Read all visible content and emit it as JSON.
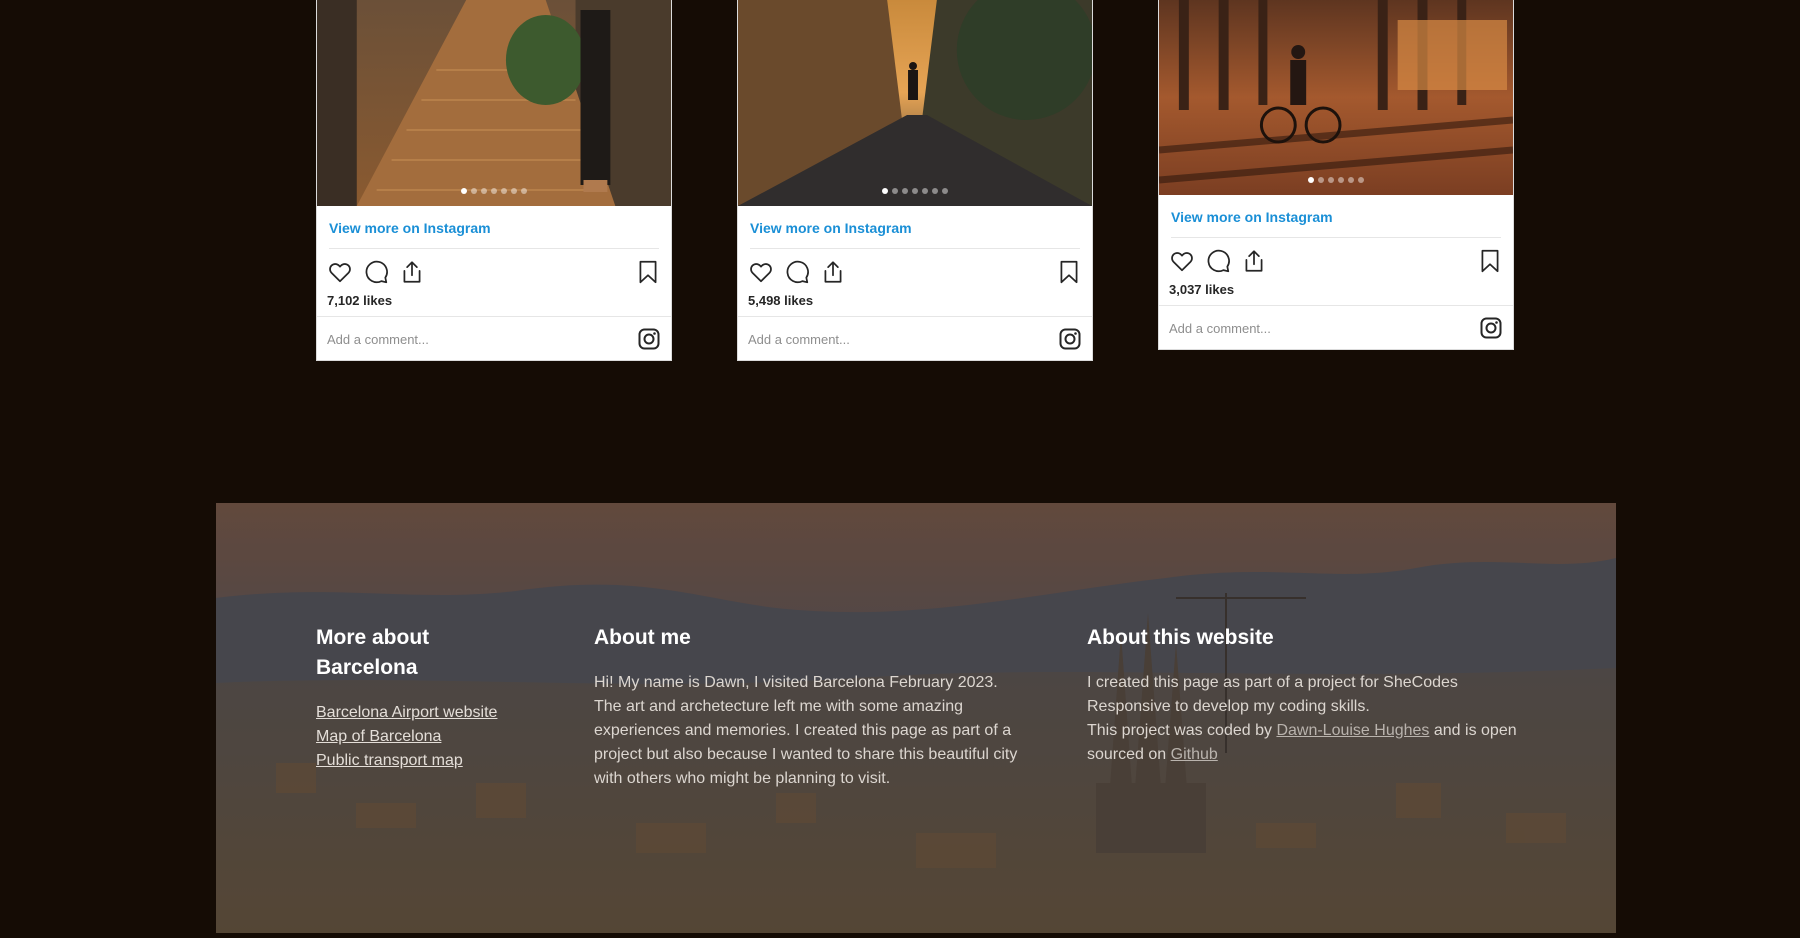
{
  "instagram_cards": [
    {
      "view_more": "View more on Instagram",
      "likes": "7,102 likes",
      "comment_placeholder": "Add a comment...",
      "slides": 7,
      "active_slide": 1
    },
    {
      "view_more": "View more on Instagram",
      "likes": "5,498 likes",
      "comment_placeholder": "Add a comment...",
      "slides": 7,
      "active_slide": 1
    },
    {
      "view_more": "View more on Instagram",
      "likes": "3,037 likes",
      "comment_placeholder": "Add a comment...",
      "slides": 6,
      "active_slide": 1
    }
  ],
  "footer": {
    "more_about": {
      "title": "More about Barcelona",
      "links": [
        "Barcelona Airport website",
        "Map of Barcelona",
        "Public transport map"
      ]
    },
    "about_me": {
      "title": "About me",
      "text": "Hi! My name is Dawn, I visited Barcelona February 2023. The art and archetecture left me with some amazing experiences and memories. I created this page as part of a project but also because I wanted to share this beautiful city with others who might be planning to visit."
    },
    "about_site": {
      "title": "About this website",
      "line1": "I created this page as part of a project for SheCodes Responsive to develop my coding skills.",
      "line2_prefix": "This project was coded by",
      "author_link": "Dawn-Louise Hughes",
      "line2_mid": "and is open sourced on",
      "github_link": "Github"
    }
  },
  "colors": {
    "page_bg": "#150c05",
    "link_blue": "#1a8fd6",
    "footer_overlay": "#3a3f44"
  },
  "icons": [
    "heart-icon",
    "comment-icon",
    "share-icon",
    "bookmark-icon",
    "instagram-icon"
  ]
}
